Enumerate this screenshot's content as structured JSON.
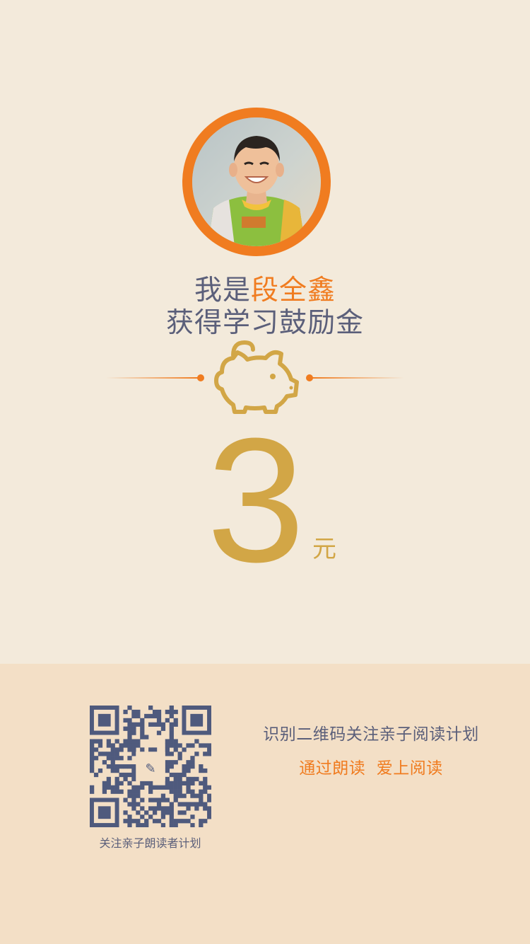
{
  "certificate": {
    "intro": "我是",
    "name": "段全鑫",
    "subtitle": "获得学习鼓励金",
    "amount": "3",
    "unit": "元"
  },
  "footer": {
    "qr_caption": "关注亲子朗读者计划",
    "follow_text": "识别二维码关注亲子阅读计划",
    "slogan": "通过朗读  爱上阅读"
  },
  "icons": {
    "avatar": "child-photo",
    "piggy": "piggy-bank-icon",
    "qr": "qr-code"
  },
  "colors": {
    "background": "#f3eadb",
    "footer_background": "#f3dfc6",
    "accent": "#f07c20",
    "gold": "#d2a646",
    "text": "#5b5f7a"
  }
}
